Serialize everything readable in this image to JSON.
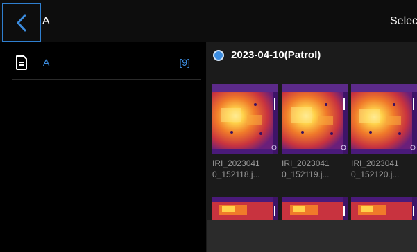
{
  "header": {
    "title": "A",
    "select_label": "Select"
  },
  "sidebar": {
    "folders": [
      {
        "name": "A",
        "count": "[9]"
      }
    ]
  },
  "main": {
    "group": {
      "label": "2023-04-10(Patrol)"
    },
    "thumbnails": [
      {
        "line1": "IRI_2023041",
        "line2": "0_152118.j..."
      },
      {
        "line1": "IRI_2023041",
        "line2": "0_152119.j..."
      },
      {
        "line1": "IRI_2023041",
        "line2": "0_152120.j..."
      }
    ]
  },
  "colors": {
    "accent": "#3c8de0",
    "thermal_hot": "#ffd24a",
    "thermal_mid": "#e8553a",
    "thermal_cold": "#4a1a7a"
  }
}
